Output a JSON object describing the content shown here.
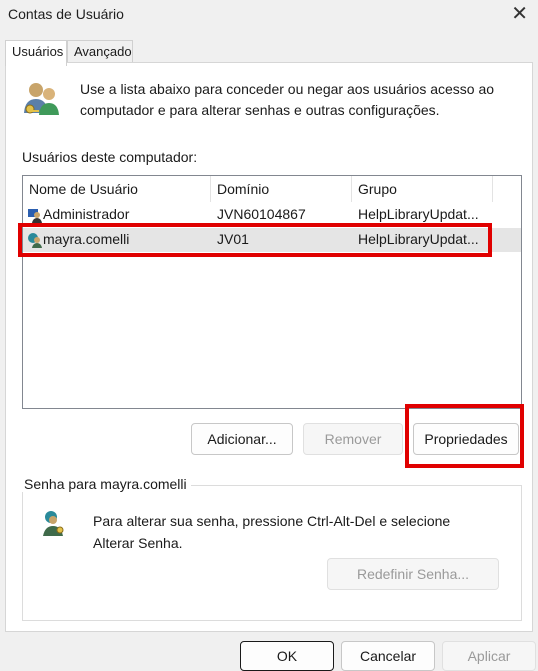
{
  "window": {
    "title": "Contas de Usuário"
  },
  "tabs": [
    {
      "label": "Usuários"
    },
    {
      "label": "Avançado"
    }
  ],
  "intro": {
    "text": "Use a lista abaixo para conceder ou negar aos usuários acesso ao computador e para alterar senhas e outras configurações."
  },
  "users_list": {
    "label": "Usuários deste computador:",
    "columns": [
      "Nome de Usuário",
      "Domínio",
      "Grupo"
    ],
    "rows": [
      {
        "name": "Administrador",
        "domain": "JVN60104867",
        "group": "HelpLibraryUpdat...",
        "icon": "admin-user-icon"
      },
      {
        "name": "mayra.comelli",
        "domain": "JV01",
        "group": "HelpLibraryUpdat...",
        "icon": "domain-user-icon",
        "selected": true
      }
    ]
  },
  "buttons": {
    "add": "Adicionar...",
    "remove": "Remover",
    "properties": "Propriedades"
  },
  "password_group": {
    "legend": "Senha para mayra.comelli",
    "text": "Para alterar sua senha, pressione Ctrl-Alt-Del e selecione Alterar Senha.",
    "reset_button": "Redefinir Senha..."
  },
  "footer": {
    "ok": "OK",
    "cancel": "Cancelar",
    "apply": "Aplicar"
  },
  "colors": {
    "highlight": "#e00000",
    "selected_row": "#e5e5e5"
  }
}
